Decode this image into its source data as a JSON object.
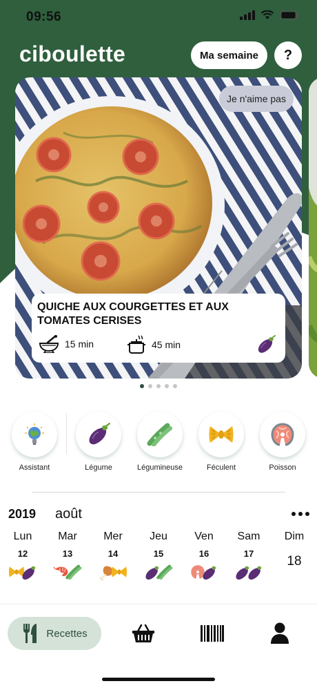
{
  "status_bar": {
    "time": "09:56"
  },
  "header": {
    "title": "ciboulette",
    "week_button": "Ma semaine",
    "help_button": "?",
    "accent_color": "#2f5f3d"
  },
  "featured_recipe": {
    "dislike_button": "Je n'aime pas",
    "title": "QUICHE AUX COURGETTES ET AUX TOMATES CERISES",
    "prep_time": "15 min",
    "cook_time": "45 min",
    "tag_icon": "eggplant-icon",
    "prep_icon": "mortar-icon",
    "cook_icon": "cooking-pot-icon"
  },
  "pager": {
    "count": 5,
    "active_index": 0
  },
  "categories": [
    {
      "label": "Assistant",
      "icon": "globe-lightbulb-icon"
    },
    {
      "label": "Légume",
      "icon": "eggplant-icon"
    },
    {
      "label": "Légumineuse",
      "icon": "green-beans-icon"
    },
    {
      "label": "Féculent",
      "icon": "pasta-bow-icon"
    },
    {
      "label": "Poisson",
      "icon": "salmon-steak-icon"
    }
  ],
  "calendar": {
    "year": "2019",
    "month": "août",
    "more_icon": "more-dots-icon",
    "days": [
      {
        "name": "Lun",
        "number": "12",
        "icons": [
          "pasta-bow-icon",
          "eggplant-icon"
        ]
      },
      {
        "name": "Mar",
        "number": "13",
        "icons": [
          "shrimp-icon",
          "green-beans-icon"
        ]
      },
      {
        "name": "Mer",
        "number": "14",
        "icons": [
          "chicken-leg-icon",
          "pasta-bow-icon"
        ]
      },
      {
        "name": "Jeu",
        "number": "15",
        "icons": [
          "eggplant-icon",
          "green-beans-icon"
        ]
      },
      {
        "name": "Ven",
        "number": "16",
        "icons": [
          "salmon-steak-icon",
          "eggplant-icon"
        ]
      },
      {
        "name": "Sam",
        "number": "17",
        "icons": [
          "eggplant-icon",
          "eggplant-icon"
        ]
      },
      {
        "name": "Dim",
        "number": "18",
        "icons": []
      }
    ]
  },
  "bottom_nav": {
    "recipes_label": "Recettes",
    "recipes_icon": "fork-knife-icon",
    "basket_icon": "basket-icon",
    "barcode_icon": "barcode-icon",
    "profile_icon": "user-icon"
  }
}
